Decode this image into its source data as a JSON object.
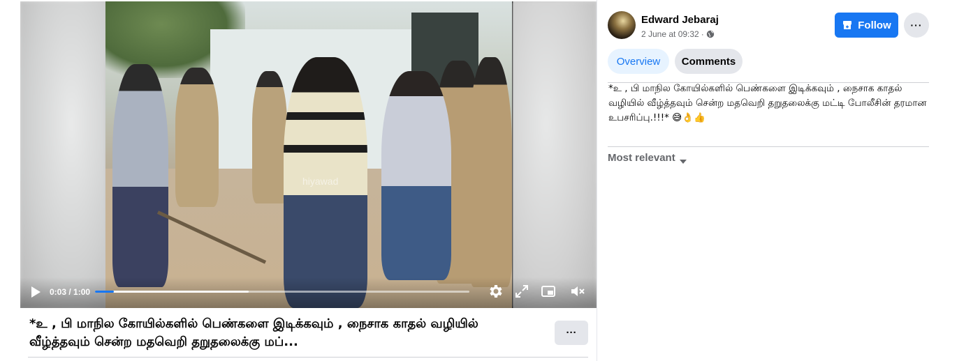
{
  "video": {
    "watermark": "hiyawad",
    "time": "0:03 / 1:00",
    "progress_fraction": 0.05,
    "buffered_fraction": 0.41,
    "icons": [
      "play-icon",
      "settings-gear-icon",
      "fullscreen-expand-icon",
      "picture-in-picture-icon",
      "volume-muted-icon"
    ]
  },
  "caption": {
    "text": "*உ , பி மாநில கோயில்களில் பெண்களை இடிக்கவும் , நைசாக காதல் வழியில் வீழ்த்தவும் சென்ற மதவெறி தறுதலைக்கு மப்...",
    "more_label": "···"
  },
  "post": {
    "author": "Edward Jebaraj",
    "date": "2 June at 09:32",
    "separator": "·",
    "follow_label": "Follow",
    "menu_label": "···",
    "text": "*உ , பி மாநில கோயில்களில் பெண்களை இடிக்கவும் , நைசாக காதல் வழியில் வீழ்த்தவும் சென்ற மதவெறி தறுதலைக்கு மட்டி போலீசின் தரமான உபசரிப்பு.!!!* 😅👌👍"
  },
  "tabs": [
    {
      "label": "Overview",
      "active": true
    },
    {
      "label": "Comments",
      "active": false
    }
  ],
  "comments": {
    "sort_label": "Most relevant"
  },
  "colors": {
    "accent": "#1877f2",
    "tab_active_bg": "#e7f3ff",
    "button_bg": "#e4e6eb",
    "secondary_text": "#65676b"
  }
}
